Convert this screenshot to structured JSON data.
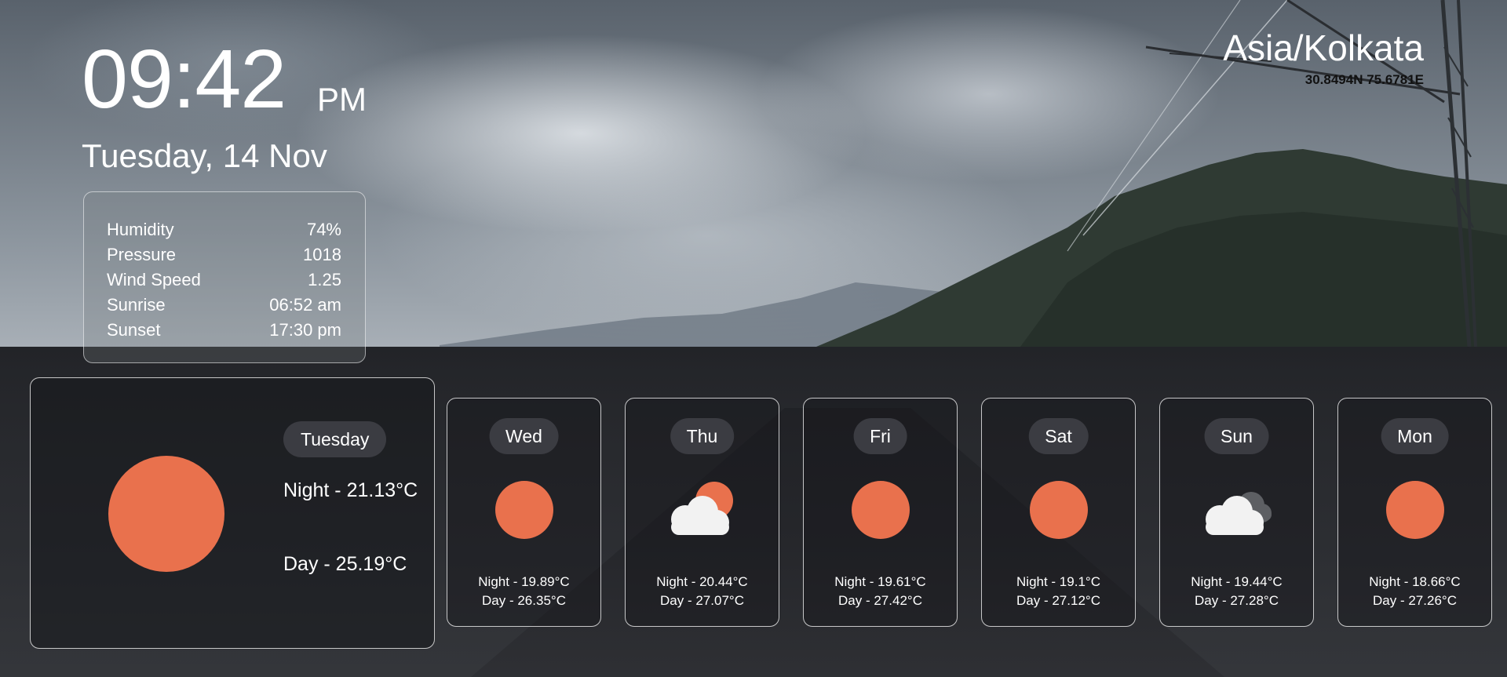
{
  "clock": {
    "time": "09:42",
    "ampm": "PM",
    "date": "Tuesday, 14 Nov"
  },
  "details": [
    {
      "label": "Humidity",
      "value": "74%"
    },
    {
      "label": "Pressure",
      "value": "1018"
    },
    {
      "label": "Wind Speed",
      "value": "1.25"
    },
    {
      "label": "Sunrise",
      "value": "06:52 am"
    },
    {
      "label": "Sunset",
      "value": "17:30 pm"
    }
  ],
  "location": {
    "timezone": "Asia/Kolkata",
    "coords": "30.8494N 75.6781E"
  },
  "current": {
    "day": "Tuesday",
    "night": "Night - 21.13°C",
    "day_temp": "Day - 25.19°C",
    "icon": "sun-icon"
  },
  "forecast": [
    {
      "day": "Wed",
      "icon": "sun-icon",
      "night": "Night - 19.89°C",
      "day_temp": "Day - 26.35°C"
    },
    {
      "day": "Thu",
      "icon": "partly-cloudy-icon",
      "night": "Night - 20.44°C",
      "day_temp": "Day - 27.07°C"
    },
    {
      "day": "Fri",
      "icon": "sun-icon",
      "night": "Night - 19.61°C",
      "day_temp": "Day - 27.42°C"
    },
    {
      "day": "Sat",
      "icon": "sun-icon",
      "night": "Night - 19.1°C",
      "day_temp": "Day - 27.12°C"
    },
    {
      "day": "Sun",
      "icon": "cloudy-icon",
      "night": "Night - 19.44°C",
      "day_temp": "Day - 27.28°C"
    },
    {
      "day": "Mon",
      "icon": "sun-icon",
      "night": "Night - 18.66°C",
      "day_temp": "Day - 27.26°C"
    }
  ],
  "colors": {
    "sun": "#e9714d",
    "pill": "#3b3c42",
    "cloud": "#f2f2f2",
    "dark_cloud": "#5d5f63"
  }
}
